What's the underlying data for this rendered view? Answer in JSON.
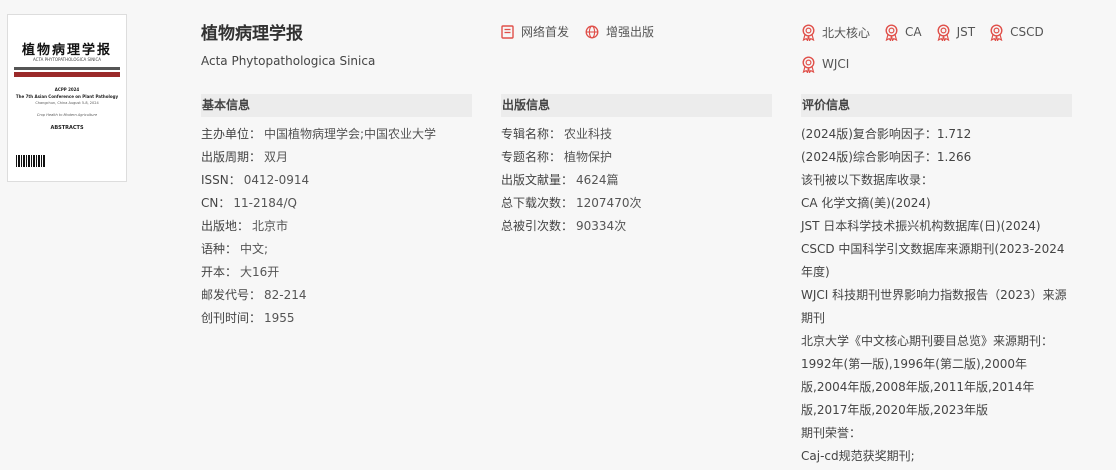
{
  "journal": {
    "title": "植物病理学报",
    "subtitle": "Acta Phytopathologica Sinica"
  },
  "cover": {
    "title_cn": "植物病理学报",
    "title_en": "ACTA PHYTOPATHOLOGICA SINICA",
    "line1": "ACPP 2024",
    "line2": "The 7th Asian Conference on Plant Pathology",
    "line3": "Changchun, China August 5-8, 2024",
    "line4": "Crop Health to Modern Agriculture",
    "abstracts": "ABSTRACTS"
  },
  "tags": [
    {
      "label": "网络首发",
      "icon": "document-icon"
    },
    {
      "label": "增强出版",
      "icon": "globe-icon"
    }
  ],
  "awards": [
    {
      "label": "北大核心",
      "icon": "award-badge-icon"
    },
    {
      "label": "CA",
      "icon": "award-badge-icon"
    },
    {
      "label": "JST",
      "icon": "award-badge-icon"
    },
    {
      "label": "CSCD",
      "icon": "award-badge-icon"
    },
    {
      "label": "WJCI",
      "icon": "award-badge-icon"
    }
  ],
  "colors": {
    "accent_red": "#e0504a",
    "section_bg": "#ececec"
  },
  "basic": {
    "header": "基本信息",
    "rows": [
      {
        "k": "主办单位：",
        "v": "中国植物病理学会;中国农业大学"
      },
      {
        "k": "出版周期：",
        "v": "双月"
      },
      {
        "k": "ISSN：",
        "v": "0412-0914"
      },
      {
        "k": "CN：",
        "v": "11-2184/Q"
      },
      {
        "k": "出版地：",
        "v": "北京市"
      },
      {
        "k": "语种：",
        "v": "中文;"
      },
      {
        "k": "开本：",
        "v": "大16开"
      },
      {
        "k": "邮发代号：",
        "v": "82-214"
      },
      {
        "k": "创刊时间：",
        "v": "1955"
      }
    ]
  },
  "publish": {
    "header": "出版信息",
    "rows": [
      {
        "k": "专辑名称：",
        "v": "农业科技"
      },
      {
        "k": "专题名称：",
        "v": "植物保护"
      },
      {
        "k": "出版文献量：",
        "v": "4624篇"
      },
      {
        "k": "总下载次数：",
        "v": "1207470次"
      },
      {
        "k": "总被引次数：",
        "v": "90334次"
      }
    ]
  },
  "evaluation": {
    "header": "评价信息",
    "rows": [
      "(2024版)复合影响因子：1.712",
      "(2024版)综合影响因子：1.266",
      "该刊被以下数据库收录：",
      "CA 化学文摘(美)(2024)",
      "JST 日本科学技术振兴机构数据库(日)(2024)",
      "CSCD 中国科学引文数据库来源期刊(2023-2024年度)",
      "WJCI 科技期刊世界影响力指数报告（2023）来源期刊",
      "北京大学《中文核心期刊要目总览》来源期刊：",
      "1992年(第一版),1996年(第二版),2000年版,2004年版,2008年版,2011年版,2014年版,2017年版,2020年版,2023年版",
      "期刊荣誉：",
      "Caj-cd规范获奖期刊;"
    ]
  }
}
